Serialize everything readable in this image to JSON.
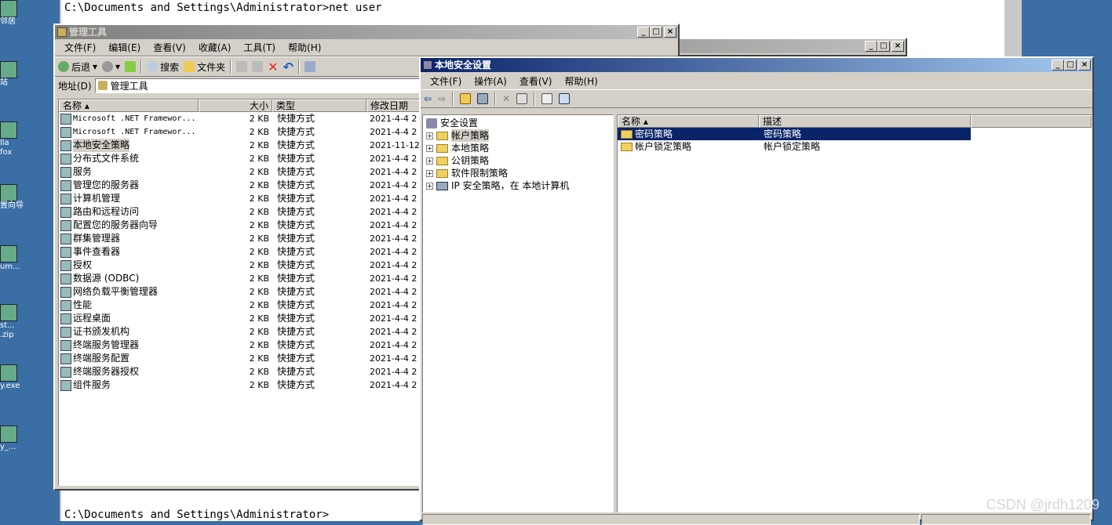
{
  "desktop_icons": [
    {
      "label": "邻居",
      "icon": "network-icon"
    },
    {
      "label": "站",
      "icon": "recycle-bin-icon"
    },
    {
      "label": "lla\nfox",
      "icon": "firefox-icon"
    },
    {
      "label": "置向导",
      "icon": "wizard-icon"
    },
    {
      "label": "um...",
      "icon": "folder-icon"
    },
    {
      "label": "st...\n.zip",
      "icon": "archive-icon"
    },
    {
      "label": "y.exe",
      "icon": "exe-icon"
    },
    {
      "label": "y_...",
      "icon": "archive-icon"
    }
  ],
  "console": {
    "line1": "C:\\Documents and Settings\\Administrator>net user",
    "line2": "C:\\Documents and Settings\\Administrator>"
  },
  "admin_window": {
    "title": "管理工具",
    "menu": [
      "文件(F)",
      "编辑(E)",
      "查看(V)",
      "收藏(A)",
      "工具(T)",
      "帮助(H)"
    ],
    "toolbar": {
      "back": "后退",
      "search": "搜索",
      "folders": "文件夹"
    },
    "address_label": "地址(D)",
    "address_value": "管理工具",
    "columns": [
      "名称",
      "大小",
      "类型",
      "修改日期"
    ],
    "rows": [
      {
        "name": "Microsoft .NET Framewor...",
        "size": "2 KB",
        "type": "快捷方式",
        "date": "2021-4-4 2",
        "mono": true
      },
      {
        "name": "Microsoft .NET Framewor...",
        "size": "2 KB",
        "type": "快捷方式",
        "date": "2021-4-4 2",
        "mono": true
      },
      {
        "name": "本地安全策略",
        "size": "2 KB",
        "type": "快捷方式",
        "date": "2021-11-12"
      },
      {
        "name": "分布式文件系统",
        "size": "2 KB",
        "type": "快捷方式",
        "date": "2021-4-4 2"
      },
      {
        "name": "服务",
        "size": "2 KB",
        "type": "快捷方式",
        "date": "2021-4-4 2"
      },
      {
        "name": "管理您的服务器",
        "size": "2 KB",
        "type": "快捷方式",
        "date": "2021-4-4 2"
      },
      {
        "name": "计算机管理",
        "size": "2 KB",
        "type": "快捷方式",
        "date": "2021-4-4 2"
      },
      {
        "name": "路由和远程访问",
        "size": "2 KB",
        "type": "快捷方式",
        "date": "2021-4-4 2"
      },
      {
        "name": "配置您的服务器向导",
        "size": "2 KB",
        "type": "快捷方式",
        "date": "2021-4-4 2"
      },
      {
        "name": "群集管理器",
        "size": "2 KB",
        "type": "快捷方式",
        "date": "2021-4-4 2"
      },
      {
        "name": "事件查看器",
        "size": "2 KB",
        "type": "快捷方式",
        "date": "2021-4-4 2"
      },
      {
        "name": "授权",
        "size": "2 KB",
        "type": "快捷方式",
        "date": "2021-4-4 2"
      },
      {
        "name": "数据源 (ODBC)",
        "size": "2 KB",
        "type": "快捷方式",
        "date": "2021-4-4 2"
      },
      {
        "name": "网络负载平衡管理器",
        "size": "2 KB",
        "type": "快捷方式",
        "date": "2021-4-4 2"
      },
      {
        "name": "性能",
        "size": "2 KB",
        "type": "快捷方式",
        "date": "2021-4-4 2"
      },
      {
        "name": "远程桌面",
        "size": "2 KB",
        "type": "快捷方式",
        "date": "2021-4-4 2"
      },
      {
        "name": "证书颁发机构",
        "size": "2 KB",
        "type": "快捷方式",
        "date": "2021-4-4 2"
      },
      {
        "name": "终端服务管理器",
        "size": "2 KB",
        "type": "快捷方式",
        "date": "2021-4-4 2"
      },
      {
        "name": "终端服务配置",
        "size": "2 KB",
        "type": "快捷方式",
        "date": "2021-4-4 2"
      },
      {
        "name": "终端服务器授权",
        "size": "2 KB",
        "type": "快捷方式",
        "date": "2021-4-4 2"
      },
      {
        "name": "组件服务",
        "size": "2 KB",
        "type": "快捷方式",
        "date": "2021-4-4 2"
      }
    ]
  },
  "secpol_window": {
    "title": "本地安全设置",
    "menu": [
      "文件(F)",
      "操作(A)",
      "查看(V)",
      "帮助(H)"
    ],
    "tree_root": "安全设置",
    "tree": [
      "帐户策略",
      "本地策略",
      "公钥策略",
      "软件限制策略",
      "IP 安全策略，在 本地计算机"
    ],
    "columns": [
      "名称",
      "描述"
    ],
    "rows": [
      {
        "name": "密码策略",
        "desc": "密码策略"
      },
      {
        "name": "帐户锁定策略",
        "desc": "帐户锁定策略"
      }
    ]
  },
  "watermark": "CSDN @jrdh1209"
}
